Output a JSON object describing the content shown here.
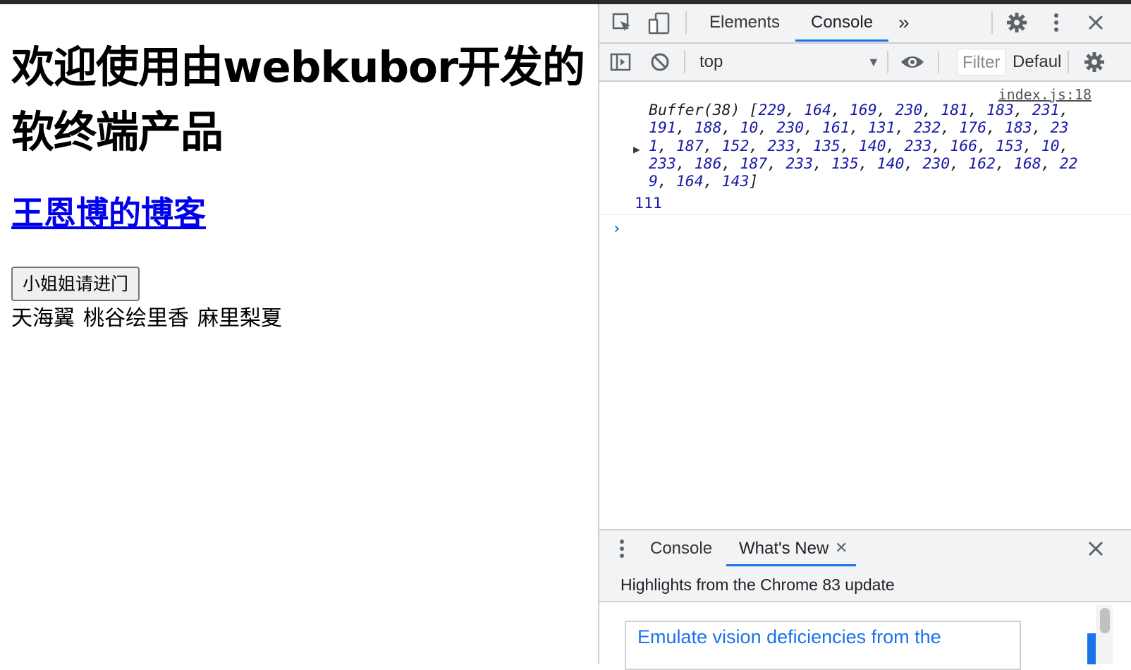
{
  "page": {
    "heading": "欢迎使用由webkubor开发的软终端产品",
    "blog_link": "王恩博的博客",
    "button_label": "小姐姐请进门",
    "names": [
      "天海翼",
      "桃谷绘里香",
      "麻里梨夏"
    ]
  },
  "devtools": {
    "tabs": {
      "elements": "Elements",
      "console": "Console",
      "more": "»"
    },
    "toolbar": {
      "context": "top",
      "filter_placeholder": "Filter",
      "levels": "Defaul"
    },
    "console": {
      "source": "index.js:18",
      "buffer_prefix": "Buffer(38) [",
      "buffer_values": [
        "229",
        "164",
        "169",
        "230",
        "181",
        "183",
        "231",
        "191",
        "188",
        "10",
        "230",
        "161",
        "131",
        "232",
        "176",
        "183",
        "231",
        "187",
        "152",
        "233",
        "135",
        "140",
        "233",
        "166",
        "153",
        "10",
        "233",
        "186",
        "187",
        "233",
        "135",
        "140",
        "230",
        "162",
        "168",
        "229",
        "164",
        "143"
      ],
      "buffer_suffix": "]",
      "number_output": "111"
    },
    "drawer": {
      "tab_console": "Console",
      "tab_whats_new": "What's New",
      "highlights": "Highlights from the Chrome 83 update",
      "card_title": "Emulate vision deficiencies from the"
    },
    "colors": {
      "accent": "#1a73e8",
      "link": "#0000ee",
      "console_number": "#1a1aa6"
    }
  }
}
